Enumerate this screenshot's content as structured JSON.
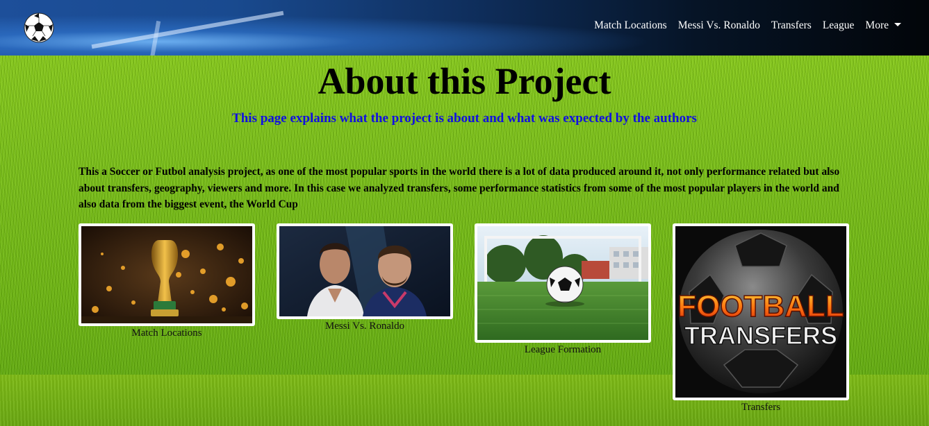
{
  "nav": {
    "links": [
      "Match Locations",
      "Messi Vs. Ronaldo",
      "Transfers",
      "League",
      "More"
    ]
  },
  "main": {
    "title": "About this Project",
    "subtitle": "This page explains what the project is about and what was expected by the authors",
    "description": "This a Soccer or Futbol analysis project, as one of the most popular sports in the world there is a lot of data produced around it, not only performance related but also about transfers, geography, viewers and more. In this case we analyzed transfers, some performance statistics from some of the most popular players in the world and also data from the biggest event, the World Cup"
  },
  "cards": [
    {
      "caption": "Match Locations",
      "image": "world-cup-trophy"
    },
    {
      "caption": "Messi Vs. Ronaldo",
      "image": "players-portrait"
    },
    {
      "caption": "League Formation",
      "image": "ball-on-field"
    },
    {
      "caption": "Transfers",
      "image": "football-transfers-logo",
      "logo_text": [
        "FOOTBALL",
        "TRANSFERS"
      ]
    }
  ],
  "colors": {
    "subtitle": "#1010e0",
    "grass": "#7cc11a",
    "navbar": "#0f2f5e"
  }
}
